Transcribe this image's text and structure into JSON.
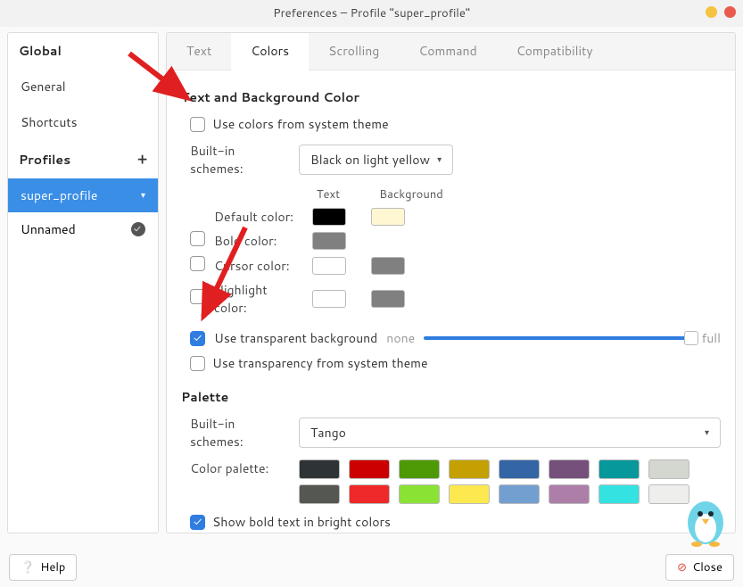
{
  "window": {
    "title": "Preferences – Profile \"super_profile\""
  },
  "sidebar": {
    "global_head": "Global",
    "items": [
      "General",
      "Shortcuts"
    ],
    "profiles_head": "Profiles",
    "profiles": [
      {
        "name": "super_profile",
        "active": true
      },
      {
        "name": "Unnamed",
        "active": false,
        "default": true
      }
    ]
  },
  "tabs": [
    "Text",
    "Colors",
    "Scrolling",
    "Command",
    "Compatibility"
  ],
  "active_tab": 1,
  "section1": {
    "title": "Text and Background Color",
    "use_system": {
      "label": "Use colors from system theme",
      "checked": false
    },
    "scheme_label": "Built-in schemes:",
    "scheme_value": "Black on light yellow",
    "col_text": "Text",
    "col_bg": "Background",
    "default_label": "Default color:",
    "default_text": "#000000",
    "default_bg": "#fff7d1",
    "bold": {
      "label": "Bold color:",
      "checked": false,
      "text": "#808080"
    },
    "cursor": {
      "label": "Cursor color:",
      "checked": false,
      "text": "#ffffff",
      "bg": "#808080"
    },
    "highlight": {
      "label": "Highlight color:",
      "checked": false,
      "text": "#ffffff",
      "bg": "#808080"
    },
    "use_transparent": {
      "label": "Use transparent background",
      "checked": true,
      "left": "none",
      "right": "full"
    },
    "use_transparent_system": {
      "label": "Use transparency from system theme",
      "checked": false
    }
  },
  "section2": {
    "title": "Palette",
    "scheme_label": "Built-in schemes:",
    "scheme_value": "Tango",
    "palette_label": "Color palette:",
    "row1": [
      "#2e3436",
      "#cc0000",
      "#4e9a06",
      "#c4a000",
      "#3465a4",
      "#75507b",
      "#06989a",
      "#d3d7cf"
    ],
    "row2": [
      "#555753",
      "#ef2929",
      "#8ae234",
      "#fce94f",
      "#729fcf",
      "#ad7fa8",
      "#34e2e2",
      "#eeeeec"
    ],
    "show_bold": {
      "label": "Show bold text in bright colors",
      "checked": true
    }
  },
  "footer": {
    "help": "Help",
    "close": "Close"
  }
}
